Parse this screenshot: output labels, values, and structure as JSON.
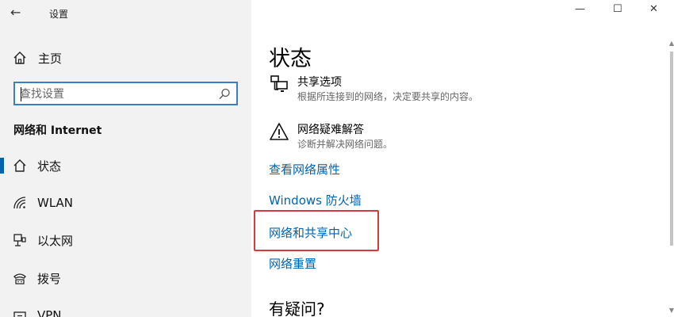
{
  "window": {
    "title": "设置",
    "back_glyph": "←",
    "minimize_glyph": "—",
    "maximize_glyph": "☐",
    "close_glyph": "✕"
  },
  "sidebar": {
    "home_label": "主页",
    "search_placeholder": "查找设置",
    "section_title": "网络和 Internet",
    "items": [
      {
        "label": "状态",
        "icon": "status-home-icon",
        "active": true
      },
      {
        "label": "WLAN",
        "icon": "wifi-icon",
        "active": false
      },
      {
        "label": "以太网",
        "icon": "ethernet-icon",
        "active": false
      },
      {
        "label": "拨号",
        "icon": "dialup-phone-icon",
        "active": false
      },
      {
        "label": "VPN",
        "icon": "vpn-icon",
        "active": false
      }
    ]
  },
  "main": {
    "page_title": "状态",
    "settings": [
      {
        "title": "共享选项",
        "desc": "根据所连接到的网络，决定要共享的内容。",
        "icon": "sharing-options-icon"
      },
      {
        "title": "网络疑难解答",
        "desc": "诊断并解决网络问题。",
        "icon": "warning-triangle-icon"
      }
    ],
    "links": [
      "查看网络属性",
      "Windows 防火墙",
      "网络和共享中心",
      "网络重置"
    ],
    "help_title": "有疑问?"
  },
  "colors": {
    "accent": "#0063b1",
    "highlight_border": "#d63a3a",
    "sidebar_bg": "#f2f2f2"
  }
}
